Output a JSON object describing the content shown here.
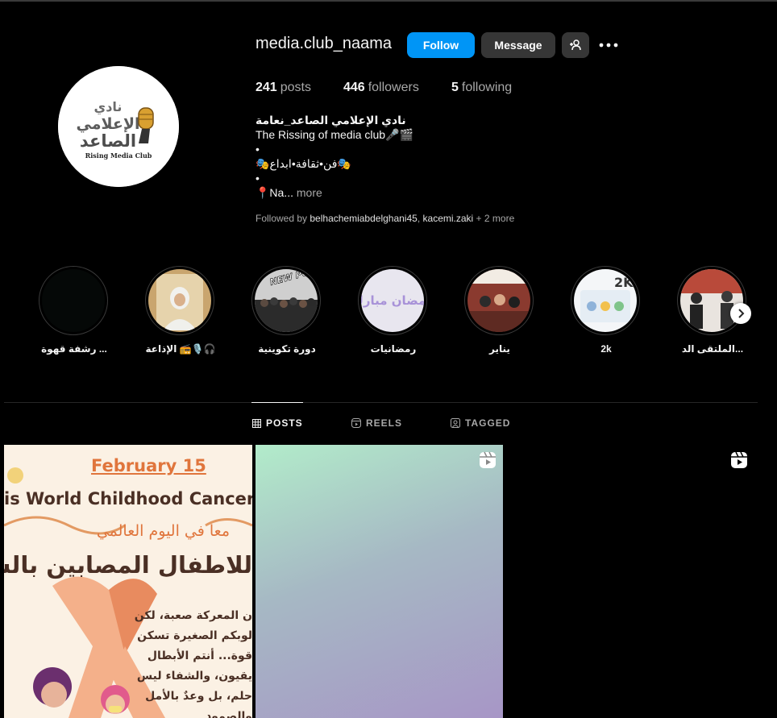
{
  "profile": {
    "username": "media.club_naama",
    "avatar_alt": "Rising Media Club",
    "avatar_text_ar_1": "نادي",
    "avatar_text_ar_2": "الإعلامي",
    "avatar_text_ar_3": "الصاعد",
    "avatar_text_en": "Rising Media Club"
  },
  "actions": {
    "follow_label": "Follow",
    "message_label": "Message",
    "add_user_icon": "person-plus-icon",
    "more_icon": "ellipsis-icon"
  },
  "stats": {
    "posts_count": "241",
    "posts_label": "posts",
    "followers_count": "446",
    "followers_label": "followers",
    "following_count": "5",
    "following_label": "following"
  },
  "bio": {
    "name": "نادي الإعلامي الصاعد_نعامة",
    "line1": "The Rissing of media club🎤🎬",
    "line2": "•",
    "line3": "🎭فن•ثقافة•ابداع🎭",
    "line4": "•",
    "line5": "📍Na...",
    "more": "more"
  },
  "followed_by": {
    "prefix": "Followed by",
    "account1": "belhachemiabdelghani45",
    "separator": ",",
    "account2": "kacemi.zaki",
    "suffix": "+ 2 more"
  },
  "highlights": [
    {
      "label": "رشفة قهوة ..."
    },
    {
      "label": "الإذاعة 📻🎙️🎧"
    },
    {
      "label": "دورة تكوينية",
      "overlay": "NEW POST!"
    },
    {
      "label": "رمضانيات",
      "overlay": "رمضان مبارك"
    },
    {
      "label": "يناير"
    },
    {
      "label": "2k",
      "overlay": "2K"
    },
    {
      "label": "الملتقى الد..."
    }
  ],
  "tabs": [
    {
      "label": "POSTS",
      "icon": "grid-icon",
      "active": true
    },
    {
      "label": "REELS",
      "icon": "reels-icon",
      "active": false
    },
    {
      "label": "TAGGED",
      "icon": "tag-person-icon",
      "active": false
    }
  ],
  "posts": [
    {
      "type": "image",
      "date": "February 15",
      "title": "is World Childhood Cancer Day",
      "ar_line1": "معا في اليوم العالمي",
      "ar_line2": "للاطفال المصابين بالسرطان",
      "body": [
        "ن المعركة صعبة، لكن",
        "لوبكم الصغيرة تسكن",
        "قوة... أنتم الأبطال",
        "يقيون، والشفاء ليس",
        "حلم، بل وعدٌ بالأمل",
        "والصمود"
      ]
    },
    {
      "type": "reel",
      "icon": "reel-icon"
    },
    {
      "type": "reel",
      "icon": "reel-icon"
    }
  ],
  "colors": {
    "follow_button": "#0095f6",
    "secondary_button": "#363636",
    "background": "#000000",
    "muted_text": "#a8a8a8"
  }
}
